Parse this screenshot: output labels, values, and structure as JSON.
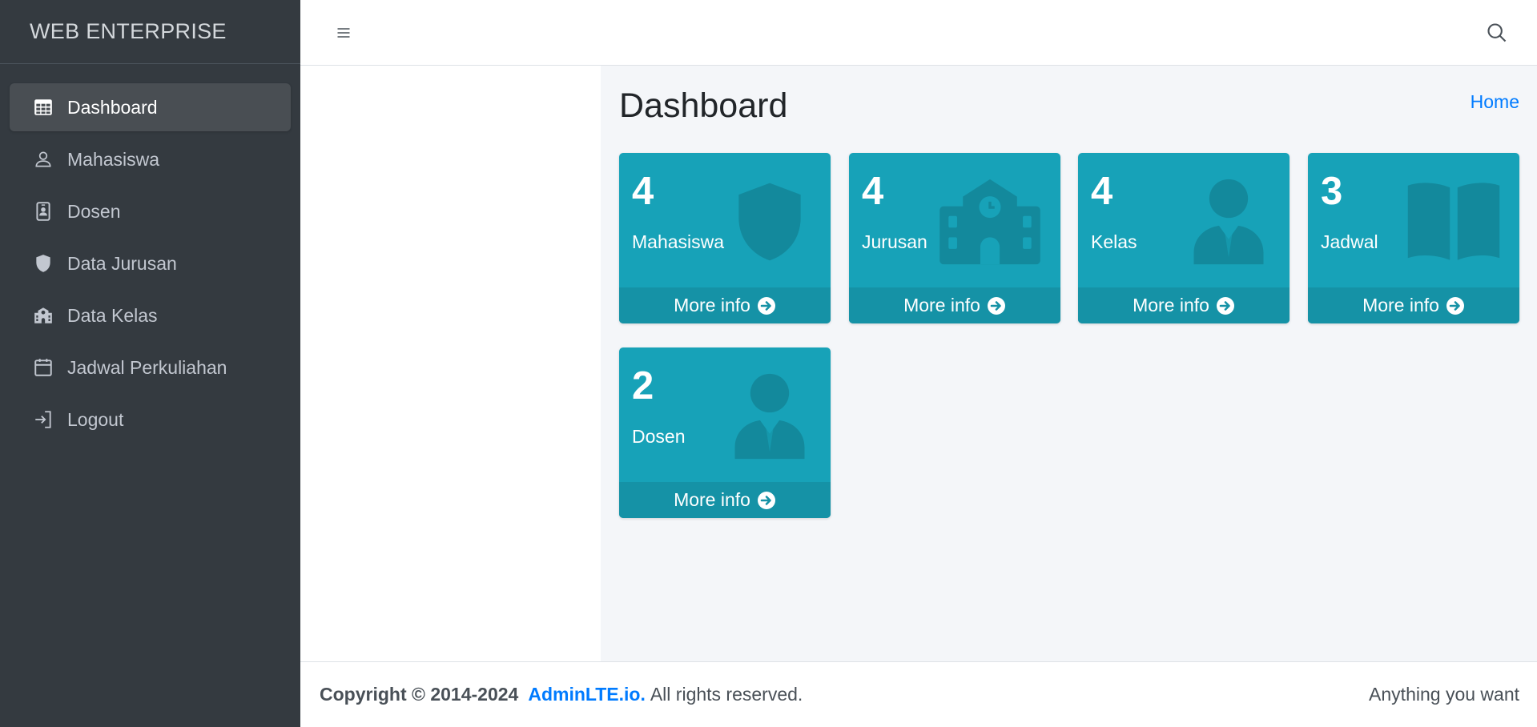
{
  "brand": {
    "title": "WEB ENTERPRISE"
  },
  "sidebar": {
    "items": [
      {
        "label": "Dashboard",
        "icon": "table-icon",
        "active": true
      },
      {
        "label": "Mahasiswa",
        "icon": "user-icon"
      },
      {
        "label": "Dosen",
        "icon": "id-badge-icon"
      },
      {
        "label": "Data Jurusan",
        "icon": "shield-icon"
      },
      {
        "label": "Data Kelas",
        "icon": "school-icon"
      },
      {
        "label": "Jadwal Perkuliahan",
        "icon": "calendar-icon"
      },
      {
        "label": "Logout",
        "icon": "sign-in-icon"
      }
    ]
  },
  "topbar": {
    "menu_icon": "hamburger-icon",
    "search_icon": "search-icon"
  },
  "header": {
    "title": "Dashboard",
    "breadcrumb": "Home"
  },
  "boxes": [
    {
      "value": "4",
      "label": "Mahasiswa",
      "icon": "shield-icon",
      "footer": "More info"
    },
    {
      "value": "4",
      "label": "Jurusan",
      "icon": "school-icon",
      "footer": "More info"
    },
    {
      "value": "4",
      "label": "Kelas",
      "icon": "user-tie-icon",
      "footer": "More info"
    },
    {
      "value": "3",
      "label": "Jadwal",
      "icon": "book-open-icon",
      "footer": "More info"
    },
    {
      "value": "2",
      "label": "Dosen",
      "icon": "user-tie-icon",
      "footer": "More info"
    }
  ],
  "footer": {
    "copyright": "Copyright © 2014-2024",
    "brand_link": "AdminLTE.io.",
    "rights": "All rights reserved.",
    "right_text": "Anything you want"
  },
  "colors": {
    "sidebar_bg": "#343a40",
    "box_bg": "#17a2b8",
    "box_footer_bg": "#1592a6",
    "link": "#007bff"
  }
}
